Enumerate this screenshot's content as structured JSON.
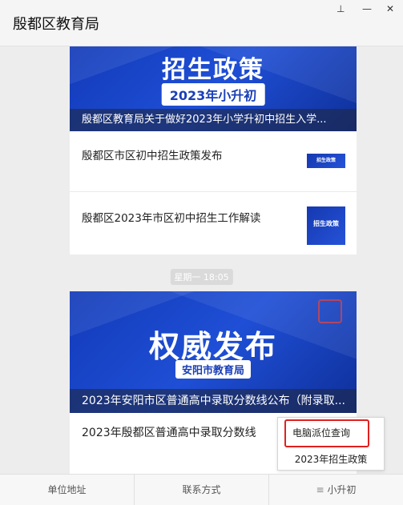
{
  "window": {
    "title": "殷都区教育局",
    "controls": {
      "pin": "⊥",
      "minimize": "—",
      "close": "✕"
    }
  },
  "article1": {
    "banner_title": "招生政策",
    "banner_pill": "2023年小升初",
    "caption": "殷都区教育局关于做好2023年小学升初中招生入学...",
    "items": [
      {
        "title": "殷都区市区初中招生政策发布",
        "thumb_label": "招生政策"
      },
      {
        "title": "殷都区2023年市区初中招生工作解读",
        "thumb_label": "招生政策"
      }
    ]
  },
  "timestamp": "星期一 18:05",
  "article2": {
    "banner_title": "权威发布",
    "banner_pill": "安阳市教育局",
    "caption": "2023年安阳市区普通高中录取分数线公布（附录取...",
    "items": [
      {
        "title": "2023年殷都区普通高中录取分数线"
      }
    ]
  },
  "popup_menu": {
    "items": [
      "电脑派位查询",
      "2023年招生政策"
    ]
  },
  "bottom_menu": {
    "tabs": [
      {
        "label": "单位地址"
      },
      {
        "label": "联系方式"
      },
      {
        "label": "小升初",
        "icon": "≡"
      }
    ]
  }
}
